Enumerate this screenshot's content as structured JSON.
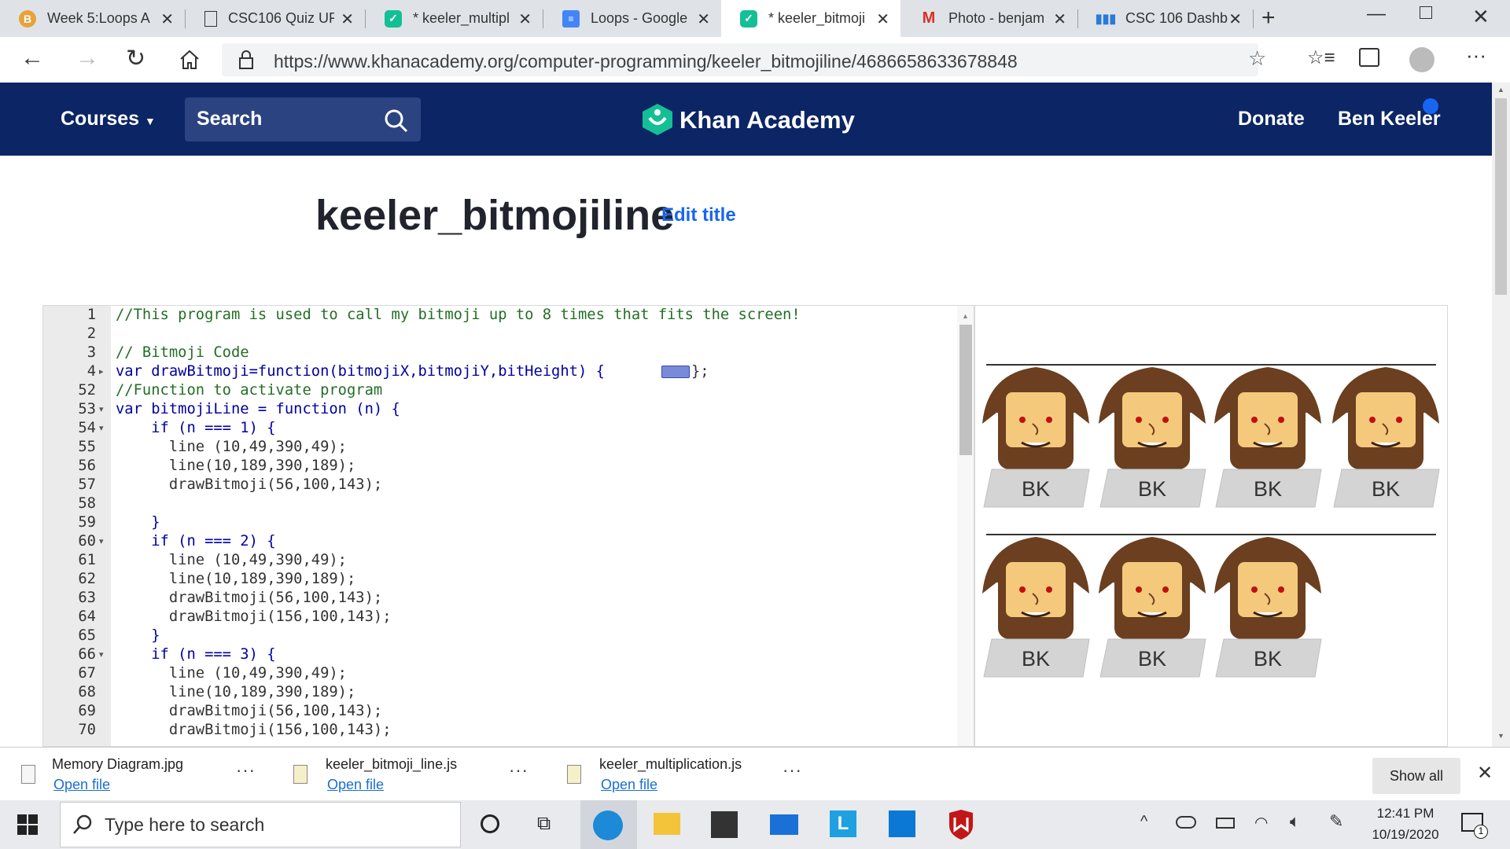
{
  "browser": {
    "tabs": [
      {
        "label": "Week 5:Loops A",
        "icon": "blackboard-icon"
      },
      {
        "label": "CSC106 Quiz UF",
        "icon": "document-icon"
      },
      {
        "label": "* keeler_multipl",
        "icon": "khan-icon"
      },
      {
        "label": "Loops - Google",
        "icon": "docs-icon"
      },
      {
        "label": "* keeler_bitmoji",
        "icon": "khan-icon",
        "active": true
      },
      {
        "label": "Photo - benjam",
        "icon": "gmail-icon"
      },
      {
        "label": "CSC 106 Dashb",
        "icon": "chart-icon"
      }
    ],
    "url": "https://www.khanacademy.org/computer-programming/keeler_bitmojiline/4686658633678848"
  },
  "header": {
    "courses": "Courses",
    "search": "Search",
    "brand": "Khan Academy",
    "donate": "Donate",
    "user": "Ben Keeler"
  },
  "program": {
    "title": "keeler_bitmojiline",
    "edit_title": "Edit title"
  },
  "code": {
    "lines": [
      {
        "n": "1",
        "text": "//This program is used to call my bitmoji up to 8 times that fits the screen!"
      },
      {
        "n": "2",
        "text": ""
      },
      {
        "n": "3",
        "text": "// Bitmoji Code"
      },
      {
        "n": "4",
        "text": "var drawBitmoji=function(bitmojiX,bitmojiY,bitHeight) {"
      },
      {
        "n": "52",
        "text": "//Function to activate program"
      },
      {
        "n": "53",
        "text": "var bitmojiLine = function (n) {"
      },
      {
        "n": "54",
        "text": "    if (n === 1) {"
      },
      {
        "n": "55",
        "text": "      line (10,49,390,49);"
      },
      {
        "n": "56",
        "text": "      line(10,189,390,189);"
      },
      {
        "n": "57",
        "text": "      drawBitmoji(56,100,143);"
      },
      {
        "n": "58",
        "text": ""
      },
      {
        "n": "59",
        "text": "    }"
      },
      {
        "n": "60",
        "text": "    if (n === 2) {"
      },
      {
        "n": "61",
        "text": "      line (10,49,390,49);"
      },
      {
        "n": "62",
        "text": "      line(10,189,390,189);"
      },
      {
        "n": "63",
        "text": "      drawBitmoji(56,100,143);"
      },
      {
        "n": "64",
        "text": "      drawBitmoji(156,100,143);"
      },
      {
        "n": "65",
        "text": "    }"
      },
      {
        "n": "66",
        "text": "    if (n === 3) {"
      },
      {
        "n": "67",
        "text": "      line (10,49,390,49);"
      },
      {
        "n": "68",
        "text": "      line(10,189,390,189);"
      },
      {
        "n": "69",
        "text": "      drawBitmoji(56,100,143);"
      },
      {
        "n": "70",
        "text": "      drawBitmoji(156,100,143);"
      }
    ]
  },
  "canvas": {
    "label": "BK",
    "row1_count": 4,
    "row2_count": 3
  },
  "downloads": [
    {
      "name": "Memory Diagram.jpg",
      "action": "Open file"
    },
    {
      "name": "keeler_bitmoji_line.js",
      "action": "Open file"
    },
    {
      "name": "keeler_multiplication.js",
      "action": "Open file"
    }
  ],
  "downloads_show_all": "Show all",
  "taskbar": {
    "search_placeholder": "Type here to search",
    "time": "12:41 PM",
    "date": "10/19/2020",
    "notification_count": "1"
  },
  "colors": {
    "khan_navy": "#0b2565",
    "khan_green": "#14bf96",
    "link_blue": "#1865f2"
  }
}
